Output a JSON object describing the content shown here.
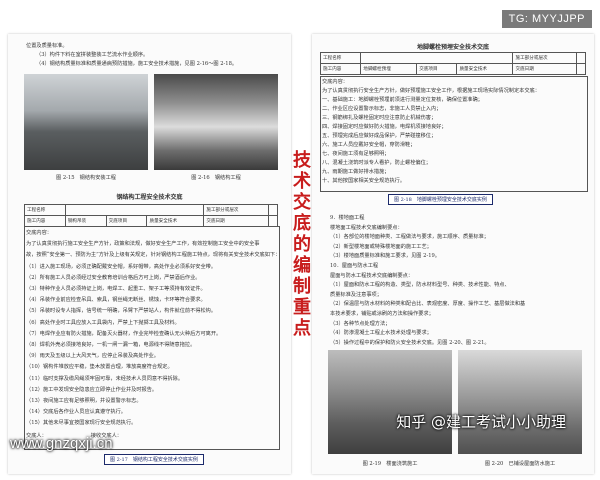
{
  "badge": "TG: MYYJJPP",
  "center_title": [
    "技",
    "术",
    "交",
    "底",
    "的",
    "编",
    "制",
    "重",
    "点"
  ],
  "footer_site": "www.gnzqxji.cn",
  "watermark": "知乎 @建工考试小小助理",
  "left_page": {
    "intro_lines": [
      "位置及质量标准。",
      "（3）构件下料在室拼装整装工艺流水作业顺序。",
      "（4）钢结构质量标准和质量通病预防措施，施工安全技术措施，见图 2-16～图 2-18。"
    ],
    "fig_captions": [
      "图 2-15　钢结构安装工程",
      "图 2-16　钢结构工程"
    ],
    "form_title": "钢结构工程安全技术交底",
    "form_rows": [
      [
        "工程名称",
        "",
        "施工部分或层次",
        ""
      ],
      [
        "施工内容",
        "钢构吊装",
        "交底项目",
        "质量安全技术",
        "交底日期",
        ""
      ]
    ],
    "body_lines": [
      "交底内容：",
      "为了认真贯彻执行施工安全生产方针，政策和法规，做好安全生产工作，有效控制施工安全中的安全事",
      "故，按照“安全第一、预防为主”方针及上级有关规定，针对钢结构工程施工特点，现将有关安全技术交底如下：",
      "（1）进入施工现场，必须正确配戴安全帽，系好帽带，高处作业必须系好安全带。",
      "（2）所有施工人员必须经过安全教育培训合格后方可上岗，严禁酒后作业。",
      "（3）特种作业人员必须持证上岗，电焊工、起重工、架子工等须持有效证件。",
      "（4）吊装作业前应检查吊具、索具，钢丝绳无断丝、锈蚀，卡环等符合要求。",
      "（5）吊装时设专人指挥，信号统一明确，吊臂下严禁站人，构件就位前不得松钩。",
      "（6）高处作业时工具应放入工具袋内，严禁上下抛掷工具及材料。",
      "（7）电焊作业应有防火措施，配备灭火器材，作业完毕检查确认无火种后方可离开。",
      "（8）焊机外壳必须接地良好，一机一闸一漏一箱，电源线不得随意拖拉。",
      "（9）雨天及五级以上大风天气，应停止吊装及高处作业。",
      "（10）钢构件堆放应平稳，垫木放置合理，堆放高度符合规定。",
      "（11）临时支撑及缆风绳须牢固可靠，未经技术人员同意不得拆除。",
      "（12）施工中发现安全隐患应立即停止作业并及时报告。",
      "（13）夜间施工应有足够照明，并设置警示标志。",
      "（14）交底后各作业人员应认真遵守执行。",
      "（15）其他未尽事宜按国家现行安全规范执行。"
    ],
    "sign_line": "交底人：　　　　　　　　　接收交底人：",
    "fig17_caption": "图 2-17　钢结构工程安全技术交底实例"
  },
  "right_page": {
    "form_title": "地脚螺栓预埋安全技术交底",
    "form_rows": [
      [
        "工程名称",
        "",
        "",
        "施工部分或层次",
        ""
      ],
      [
        "施工内容",
        "地脚螺栓预埋",
        "交底项目",
        "质量安全技术",
        "交底日期",
        ""
      ]
    ],
    "form_lines": [
      "交底内容：",
      "为了认真贯彻执行安全生产方针，做好预埋施工安全工作，根据施工现场实际情况制定本交底：",
      "一、基础施工：地脚螺栓预埋前须进行测量定位复核，确保位置准确；",
      "二、作业区应设置警示标志，非施工人员禁止入内；",
      "三、钢筋绑扎及螺栓固定时应注意防止机械伤害；",
      "四、焊接固定时应做好防火措施，电焊机须接地良好；",
      "五、预埋完成后应做好成品保护，严禁碰撞移位；",
      "六、施工人员应戴好安全帽，穿防滑鞋；",
      "七、夜间施工须有足够照明；",
      "八、混凝土浇筑时派专人看护，防止螺栓偏位；",
      "九、雨期施工做好排水措施；",
      "十、其他按国家相关安全规范执行。"
    ],
    "fig18_caption": "图 2-18　地脚螺栓预埋安全技术交底实例",
    "section_lines": [
      "9．楼地面工程",
      "楼地面工程技术交底编制要点：",
      "（1）各部位的楼地面种类、工程做法与要求，施工顺序、质量标准；",
      "（2）新型楼地面或特殊楼地面的施工工艺；",
      "（3）楼地面质量标准和施工要求，见图 2-19。",
      "10．屋面与防水工程",
      "屋面与防水工程技术交底编制要点：",
      "（1）屋面和防水工程的构造、类型，防水材料型号、种类、技术性能、特点、",
      "质量标准及注意事项；",
      "（2）保温层与防水材料的种类和配合比、表观密度、厚度、操作工艺、基层做法和基",
      "本技术要求，铺贴或涂刷的方法和操作要求；",
      "（3）各种节点处理方法；",
      "（4）防渗混凝土工程止水技术处理与要求；",
      "（5）操作过程中的保护和防火安全技术交底。见图 2-20、图 2-21。"
    ],
    "fig_captions": [
      "图 2-19　楼面浇筑施工",
      "图 2-20　已铺设屋面防水施工"
    ]
  }
}
